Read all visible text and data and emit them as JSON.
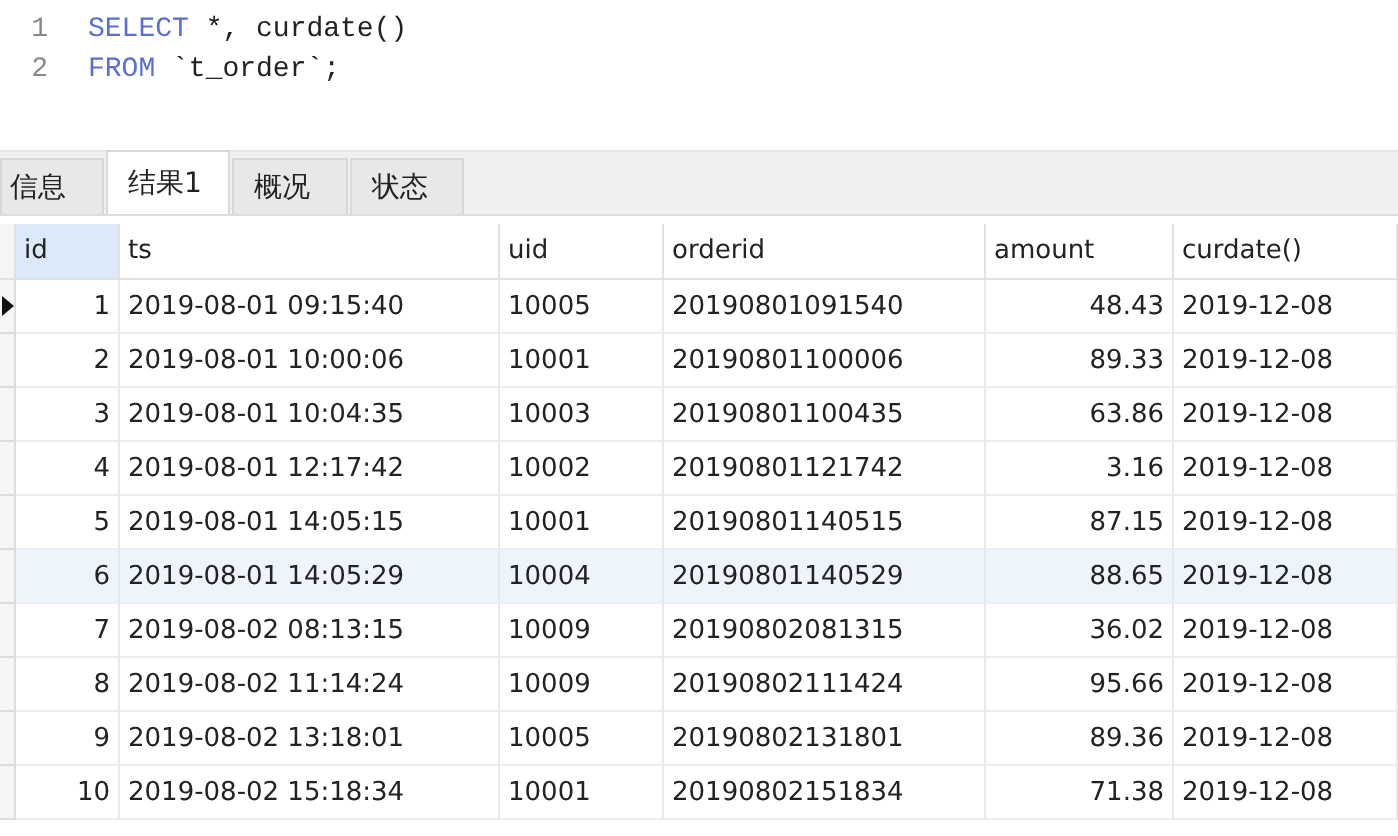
{
  "editor": {
    "lines": [
      {
        "number": "1",
        "tokens": [
          {
            "kind": "keyword",
            "text": "SELECT"
          },
          {
            "kind": "plain",
            "text": " *, curdate()"
          }
        ]
      },
      {
        "number": "2",
        "tokens": [
          {
            "kind": "keyword",
            "text": "FROM"
          },
          {
            "kind": "plain",
            "text": " `t_order`;"
          }
        ]
      }
    ]
  },
  "tabs": [
    {
      "label": "信息",
      "selected": false
    },
    {
      "label": "结果1",
      "selected": true
    },
    {
      "label": "概况",
      "selected": false
    },
    {
      "label": "状态",
      "selected": false
    }
  ],
  "table": {
    "columns": [
      {
        "label": "id",
        "kind": "number",
        "selected": true
      },
      {
        "label": "ts",
        "kind": "text",
        "selected": false
      },
      {
        "label": "uid",
        "kind": "text",
        "selected": false
      },
      {
        "label": "orderid",
        "kind": "text",
        "selected": false
      },
      {
        "label": "amount",
        "kind": "number",
        "selected": false
      },
      {
        "label": "curdate()",
        "kind": "text",
        "selected": false
      }
    ],
    "rows": [
      {
        "current": true,
        "selected": false,
        "cells": [
          "1",
          "2019-08-01 09:15:40",
          "10005",
          "20190801091540",
          "48.43",
          "2019-12-08"
        ]
      },
      {
        "current": false,
        "selected": false,
        "cells": [
          "2",
          "2019-08-01 10:00:06",
          "10001",
          "20190801100006",
          "89.33",
          "2019-12-08"
        ]
      },
      {
        "current": false,
        "selected": false,
        "cells": [
          "3",
          "2019-08-01 10:04:35",
          "10003",
          "20190801100435",
          "63.86",
          "2019-12-08"
        ]
      },
      {
        "current": false,
        "selected": false,
        "cells": [
          "4",
          "2019-08-01 12:17:42",
          "10002",
          "20190801121742",
          "3.16",
          "2019-12-08"
        ]
      },
      {
        "current": false,
        "selected": false,
        "cells": [
          "5",
          "2019-08-01 14:05:15",
          "10001",
          "20190801140515",
          "87.15",
          "2019-12-08"
        ]
      },
      {
        "current": false,
        "selected": true,
        "cells": [
          "6",
          "2019-08-01 14:05:29",
          "10004",
          "20190801140529",
          "88.65",
          "2019-12-08"
        ]
      },
      {
        "current": false,
        "selected": false,
        "cells": [
          "7",
          "2019-08-02 08:13:15",
          "10009",
          "20190802081315",
          "36.02",
          "2019-12-08"
        ]
      },
      {
        "current": false,
        "selected": false,
        "cells": [
          "8",
          "2019-08-02 11:14:24",
          "10009",
          "20190802111424",
          "95.66",
          "2019-12-08"
        ]
      },
      {
        "current": false,
        "selected": false,
        "cells": [
          "9",
          "2019-08-02 13:18:01",
          "10005",
          "20190802131801",
          "89.36",
          "2019-12-08"
        ]
      },
      {
        "current": false,
        "selected": false,
        "cells": [
          "10",
          "2019-08-02 15:18:34",
          "10001",
          "20190802151834",
          "71.38",
          "2019-12-08"
        ]
      }
    ]
  }
}
